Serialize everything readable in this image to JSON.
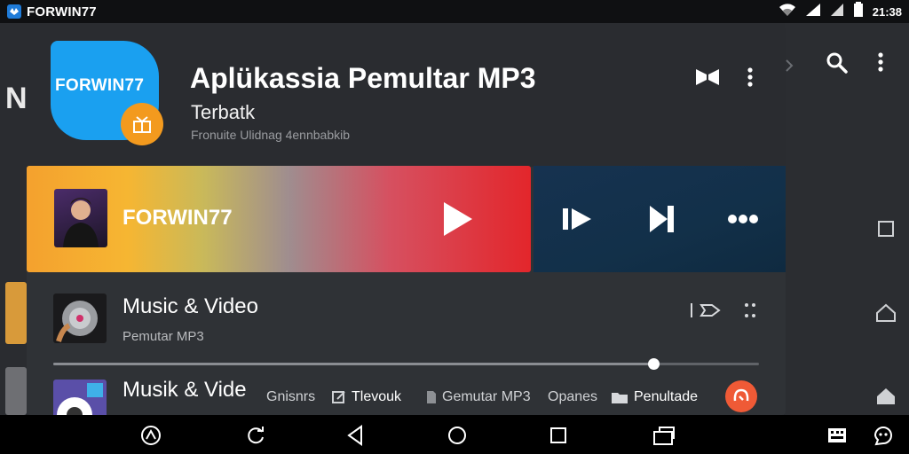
{
  "status_bar": {
    "app_name": "FORWIN77",
    "time": "21:38",
    "icons": [
      "wifi-icon",
      "signal-icon",
      "signal-icon",
      "battery-icon"
    ]
  },
  "background": {
    "partial_letter": "N",
    "icons": [
      "search-icon",
      "more-vert-icon",
      "square-icon",
      "home-outline-icon",
      "home-filled-icon"
    ]
  },
  "header": {
    "logo_text": "FORWIN77",
    "title": "Aplükassia Pemultar MP3",
    "subtitle": "Terbatk",
    "description": "Fronuite Ulidnag 4ennbabkib",
    "icons": [
      "bookmark-icon",
      "more-vert-icon"
    ]
  },
  "now_playing": {
    "title": "FORWIN77",
    "controls": [
      "skip-icon",
      "next-track-icon",
      "more-horiz-icon"
    ]
  },
  "list": [
    {
      "title": "Music & Video",
      "subtitle": "Pemutar MP3",
      "icons": [
        "cast-icon",
        "drag-handle-icon"
      ]
    },
    {
      "title": "Musik & Vide"
    }
  ],
  "progress": {
    "value": 0.85
  },
  "tags": [
    {
      "label": "Gnisnrs"
    },
    {
      "label": "Tlevouk"
    },
    {
      "label": "Gemutar MP3"
    },
    {
      "label": "Opanes"
    },
    {
      "label": "Penultade"
    }
  ],
  "colors": {
    "accent_blue": "#1aa0f0",
    "accent_orange": "#f39a1e",
    "fab": "#ef5a36",
    "controls_bg": "#163250"
  }
}
